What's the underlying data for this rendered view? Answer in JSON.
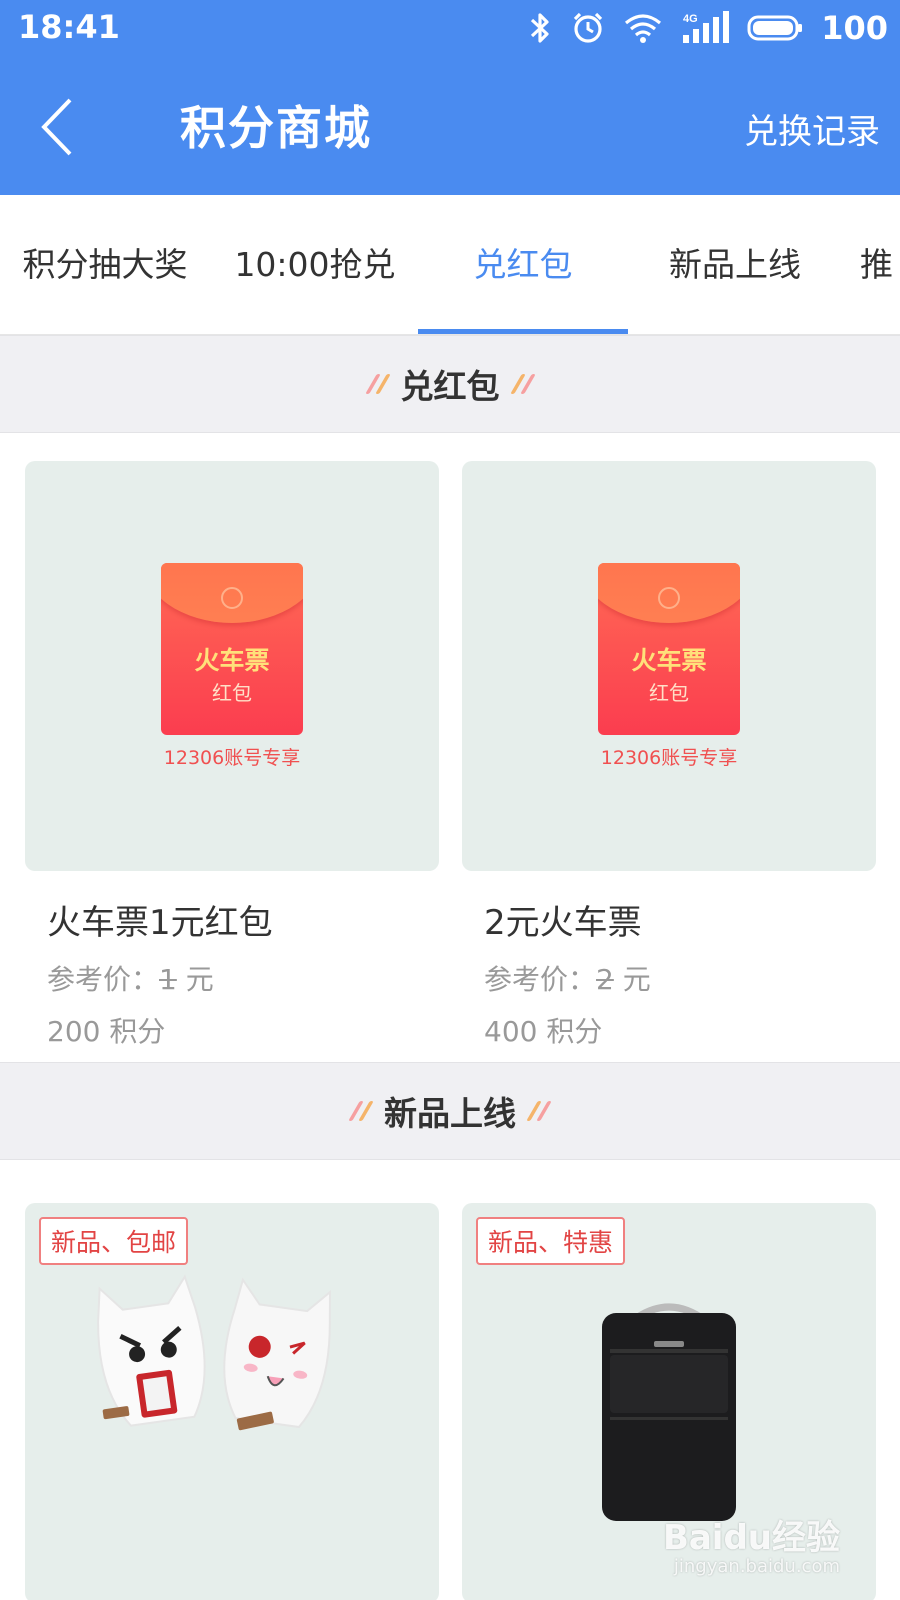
{
  "status_bar": {
    "time": "18:41",
    "network": "4G",
    "battery": "100"
  },
  "header": {
    "title": "积分商城",
    "record_button": "兑换记录"
  },
  "tabs": [
    {
      "label": "积分抽大奖"
    },
    {
      "label": "10:00抢兑"
    },
    {
      "label": "兑红包",
      "active": true
    },
    {
      "label": "新品上线"
    },
    {
      "label": "推"
    }
  ],
  "sections": {
    "red_packet": {
      "title": "兑红包",
      "items": [
        {
          "packet_title": "火车票",
          "packet_subtitle": "红包",
          "packet_note": "12306账号专享",
          "name": "火车票1元红包",
          "ref_label": "参考价：",
          "ref_value": "1",
          "ref_unit": "元",
          "points": "200 积分"
        },
        {
          "packet_title": "火车票",
          "packet_subtitle": "红包",
          "packet_note": "12306账号专享",
          "name": "2元火车票",
          "ref_label": "参考价：",
          "ref_value": "2",
          "ref_unit": "元",
          "points": "400 积分"
        }
      ]
    },
    "new_products": {
      "title": "新品上线",
      "items": [
        {
          "tag": "新品、包邮",
          "image": "cartoon-cat-power-bank"
        },
        {
          "tag": "新品、特惠",
          "image": "black-backpack"
        }
      ]
    }
  },
  "watermark": {
    "logo": "Baidu经验",
    "url": "jingyan.baidu.com"
  },
  "colors": {
    "primary": "#4a8bf0",
    "card_bg": "#e6eeeb",
    "tag_red": "#e24444"
  }
}
